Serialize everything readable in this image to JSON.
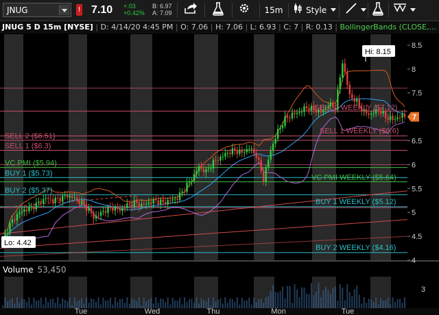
{
  "toolbar": {
    "symbol": "JNUG",
    "flag": "!",
    "last_price": "7.10",
    "net_change": "+.03",
    "pct_change": "+0.42%",
    "bid": "B: 6.97",
    "ask": "A: 7.09",
    "interval": "15m",
    "style_label": "Style",
    "icons": [
      "share-icon",
      "flask-icon",
      "gear-icon",
      "drawing-tool-icon",
      "pencil-icon",
      "flask-icon",
      "pattern-icon"
    ]
  },
  "study_line": {
    "title": "JNUG 5 D 15m [NYSE]",
    "date": "D: 4/14/20 4:45 PM",
    "open": "O: 7.06",
    "high": "H: 7.06",
    "low": "L: 6.93",
    "close": "C: 7",
    "range": "R: 0.13",
    "study": "BollingerBands (CLOSE,..."
  },
  "colors": {
    "sell_line": "#c8506a",
    "buy_line": "#2bbfc9",
    "vcpmi_line": "#3fbf3f",
    "trend_line": "#d04a4a",
    "bb_upper": "#d35a1e",
    "bb_lower": "#b36ad8",
    "bb_mid": "#2fa6ff",
    "candle_up": "#2ecc40",
    "candle_down": "#e04040",
    "current_price": "#e8752a"
  },
  "chart_data": {
    "type": "candlestick",
    "symbol": "JNUG",
    "timeframe": "5 D 15m",
    "x_labels": [
      "Tue",
      "Wed",
      "Thu",
      "Mon",
      "Tue"
    ],
    "y_ticks": [
      "8.5",
      "8",
      "7.5",
      "7",
      "6.5",
      "6",
      "5.5",
      "5",
      "4.5",
      "4"
    ],
    "ylim": [
      4.0,
      8.7
    ],
    "current_price": "7",
    "high_label": "Hi: 8.15",
    "low_label": "Lo: 4.42",
    "levels": [
      {
        "label": "SELL 2 ($6.51)",
        "value": 6.51,
        "kind": "sell",
        "side": "left"
      },
      {
        "label": "SELL 1 ($6.3)",
        "value": 6.3,
        "kind": "sell",
        "side": "left"
      },
      {
        "label": "VC PMI ($5.94)",
        "value": 5.94,
        "kind": "vcpmi",
        "side": "left"
      },
      {
        "label": "BUY 1 ($5.73)",
        "value": 5.73,
        "kind": "buy",
        "side": "left"
      },
      {
        "label": "BUY 2 ($5.37)",
        "value": 5.37,
        "kind": "buy",
        "side": "left"
      },
      {
        "label": "SELL 2 WEEKLY ($7.12)",
        "value": 7.12,
        "kind": "sell",
        "side": "right"
      },
      {
        "label": "SELL 1 WEEKLY ($6.6)",
        "value": 6.6,
        "kind": "sell",
        "side": "right"
      },
      {
        "label": "VC PMI WEEKLY ($5.64)",
        "value": 5.64,
        "kind": "vcpmi",
        "side": "right"
      },
      {
        "label": "BUY 1 WEEKLY ($5.12)",
        "value": 5.12,
        "kind": "buy",
        "side": "right"
      },
      {
        "label": "BUY 2 WEEKLY ($4.16)",
        "value": 4.16,
        "kind": "buy",
        "side": "right"
      }
    ],
    "extra_lines": [
      7.6,
      6.0,
      5.1
    ],
    "price_path": [
      [
        0,
        4.42
      ],
      [
        3,
        4.75
      ],
      [
        6,
        4.95
      ],
      [
        9,
        5.05
      ],
      [
        12,
        5.1
      ],
      [
        15,
        5.2
      ],
      [
        18,
        5.3
      ],
      [
        21,
        5.25
      ],
      [
        24,
        5.3
      ],
      [
        27,
        5.35
      ],
      [
        30,
        5.3
      ],
      [
        33,
        5.2
      ],
      [
        36,
        5.05
      ],
      [
        38,
        4.9
      ],
      [
        40,
        4.95
      ],
      [
        43,
        5.05
      ],
      [
        46,
        5.1
      ],
      [
        49,
        5.05
      ],
      [
        52,
        5.15
      ],
      [
        55,
        5.2
      ],
      [
        58,
        5.15
      ],
      [
        61,
        5.2
      ],
      [
        64,
        5.25
      ],
      [
        67,
        5.2
      ],
      [
        70,
        5.25
      ],
      [
        73,
        5.3
      ],
      [
        76,
        5.5
      ],
      [
        79,
        5.7
      ],
      [
        82,
        5.95
      ],
      [
        85,
        5.85
      ],
      [
        88,
        6.05
      ],
      [
        91,
        6.15
      ],
      [
        94,
        6.25
      ],
      [
        97,
        6.3
      ],
      [
        100,
        6.25
      ],
      [
        103,
        6.35
      ],
      [
        106,
        6.2
      ],
      [
        109,
        5.7
      ],
      [
        112,
        6.3
      ],
      [
        115,
        6.7
      ],
      [
        118,
        6.95
      ],
      [
        121,
        7.05
      ],
      [
        124,
        7.1
      ],
      [
        127,
        7.2
      ],
      [
        130,
        7.15
      ],
      [
        133,
        7.1
      ],
      [
        136,
        7.25
      ],
      [
        139,
        7.2
      ],
      [
        142,
        8.15
      ],
      [
        145,
        7.45
      ],
      [
        148,
        7.3
      ],
      [
        151,
        7.1
      ],
      [
        154,
        7.05
      ],
      [
        157,
        7.15
      ],
      [
        160,
        7.0
      ],
      [
        163,
        6.95
      ],
      [
        166,
        7.0
      ]
    ],
    "volume": {
      "label": "Volume",
      "value": "53,450",
      "ticks": [
        "3"
      ]
    }
  }
}
